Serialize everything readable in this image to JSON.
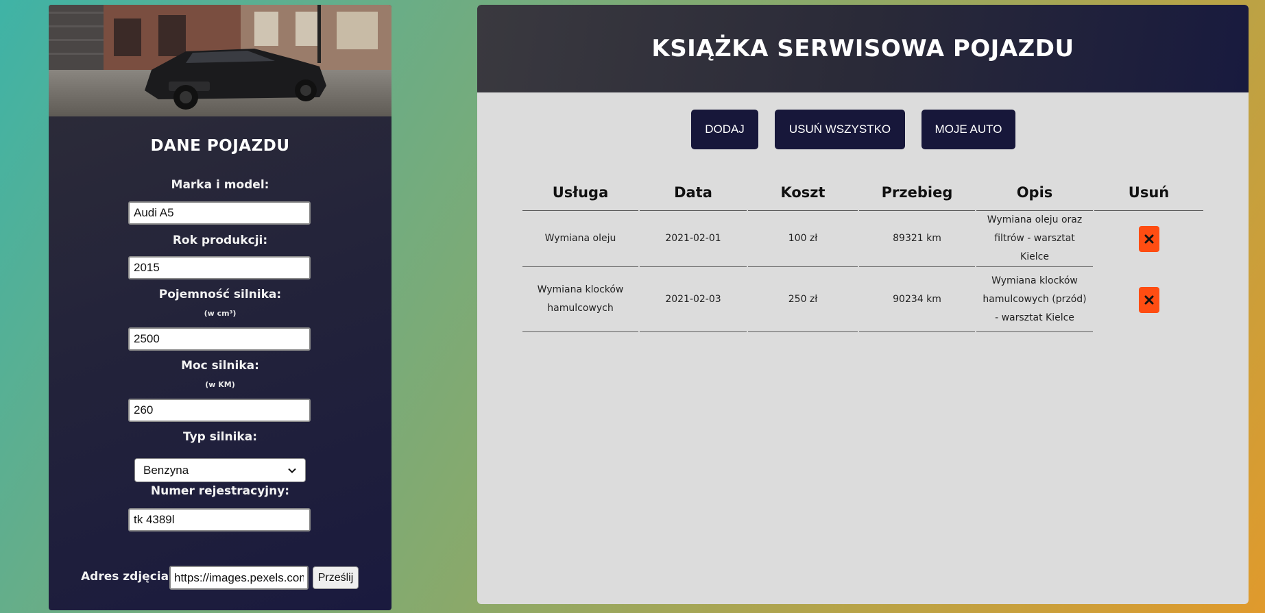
{
  "vehicle_panel": {
    "title": "DANE POJAZDU",
    "fields": {
      "make_model": {
        "label": "Marka i model:",
        "value": "Audi A5"
      },
      "year": {
        "label": "Rok produkcji:",
        "value": "2015"
      },
      "displacement": {
        "label": "Pojemność silnika:",
        "note": "(w cm³)",
        "value": "2500"
      },
      "power": {
        "label": "Moc silnika:",
        "note": "(w KM)",
        "value": "260"
      },
      "engine_type": {
        "label": "Typ silnika:",
        "value": "Benzyna"
      },
      "registration": {
        "label": "Numer rejestracyjny:",
        "value": "tk 4389l"
      }
    },
    "photo_url": {
      "label": "Adres zdjęcia:",
      "value": "https://images.pexels.com"
    },
    "send_label": "Prześlij"
  },
  "service_book": {
    "title": "KSIĄŻKA SERWISOWA POJAZDU",
    "actions": {
      "add": "DODAJ",
      "delete_all": "USUŃ WSZYSTKO",
      "my_car": "MOJE AUTO"
    },
    "table": {
      "headers": [
        "Usługa",
        "Data",
        "Koszt",
        "Przebieg",
        "Opis",
        "Usuń"
      ],
      "rows": [
        {
          "service": "Wymiana oleju",
          "date": "2021-02-01",
          "cost": "100 zł",
          "mileage": "89321 km",
          "description": "Wymiana oleju oraz filtrów - warsztat Kielce"
        },
        {
          "service": "Wymiana klocków hamulcowych",
          "date": "2021-02-03",
          "cost": "250 zł",
          "mileage": "90234 km",
          "description": "Wymiana klocków hamulcowych (przód) - warsztat Kielce"
        }
      ]
    }
  },
  "colors": {
    "panel_dark": "#1a1a3e",
    "button_bg": "#17173a",
    "delete_button": "#ff4d12",
    "table_bg": "#dcdcdc"
  }
}
